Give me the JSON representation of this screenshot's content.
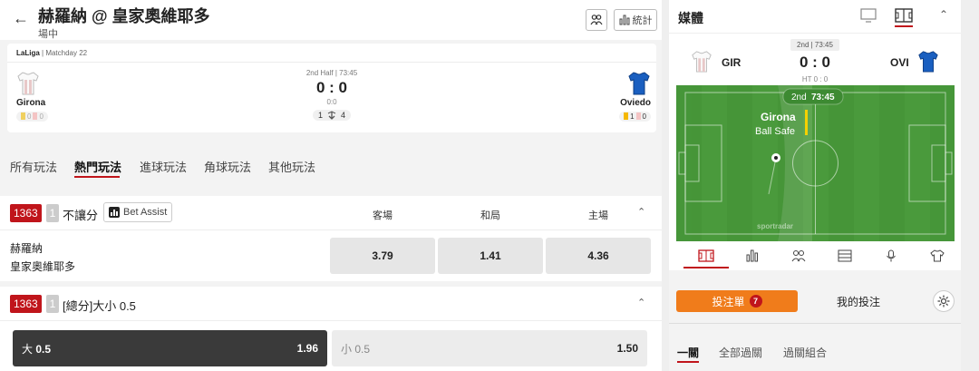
{
  "header": {
    "title": "赫羅納 @ 皇家奧維耶多",
    "subtitle": "場中",
    "stats_label": "統計"
  },
  "match": {
    "league": "LaLiga",
    "matchday": "Matchday 22",
    "period": "2nd Half | 73:45",
    "score": "0 : 0",
    "sub_score": "0:0",
    "subs_home": "1",
    "subs_away": "4",
    "home": {
      "name": "Girona",
      "yellow": "0",
      "red": "0",
      "shirt_color": "#ffffff"
    },
    "away": {
      "name": "Oviedo",
      "yellow": "1",
      "red": "0",
      "shirt_color": "#1a5fc0"
    }
  },
  "tabs": [
    "所有玩法",
    "熱門玩法",
    "進球玩法",
    "角球玩法",
    "其他玩法"
  ],
  "active_tab": "熱門玩法",
  "market1": {
    "id": "1363",
    "num": "1",
    "name": "不讓分",
    "bet_assist": "Bet Assist",
    "col_away": "客場",
    "col_draw": "和局",
    "col_home": "主場",
    "team1": "赫羅納",
    "team2": "皇家奧維耶多",
    "odds": [
      "3.79",
      "1.41",
      "4.36"
    ]
  },
  "market2": {
    "id": "1363",
    "num": "1",
    "name": "[總分]大小 0.5",
    "over_label": "大",
    "over_line": "0.5",
    "over_odds": "1.96",
    "under_label": "小 0.5",
    "under_odds": "1.50"
  },
  "media": {
    "title": "媒體",
    "period": "2nd | 73:45",
    "score": "0 : 0",
    "ht": "HT 0 : 0",
    "home_abbr": "GIR",
    "away_abbr": "OVI",
    "field_period": "2nd",
    "field_time": "73:45",
    "event_team": "Girona",
    "event_text": "Ball Safe",
    "watermark": "sportradar",
    "pitch_color": "#4a9a3c"
  },
  "betslip": {
    "slip_label": "投注單",
    "slip_count": "7",
    "my_bets": "我的投注",
    "tabs": [
      "一關",
      "全部過關",
      "過關組合"
    ]
  },
  "colors": {
    "brand_red": "#c0151b",
    "accent_orange": "#f07c1b"
  }
}
